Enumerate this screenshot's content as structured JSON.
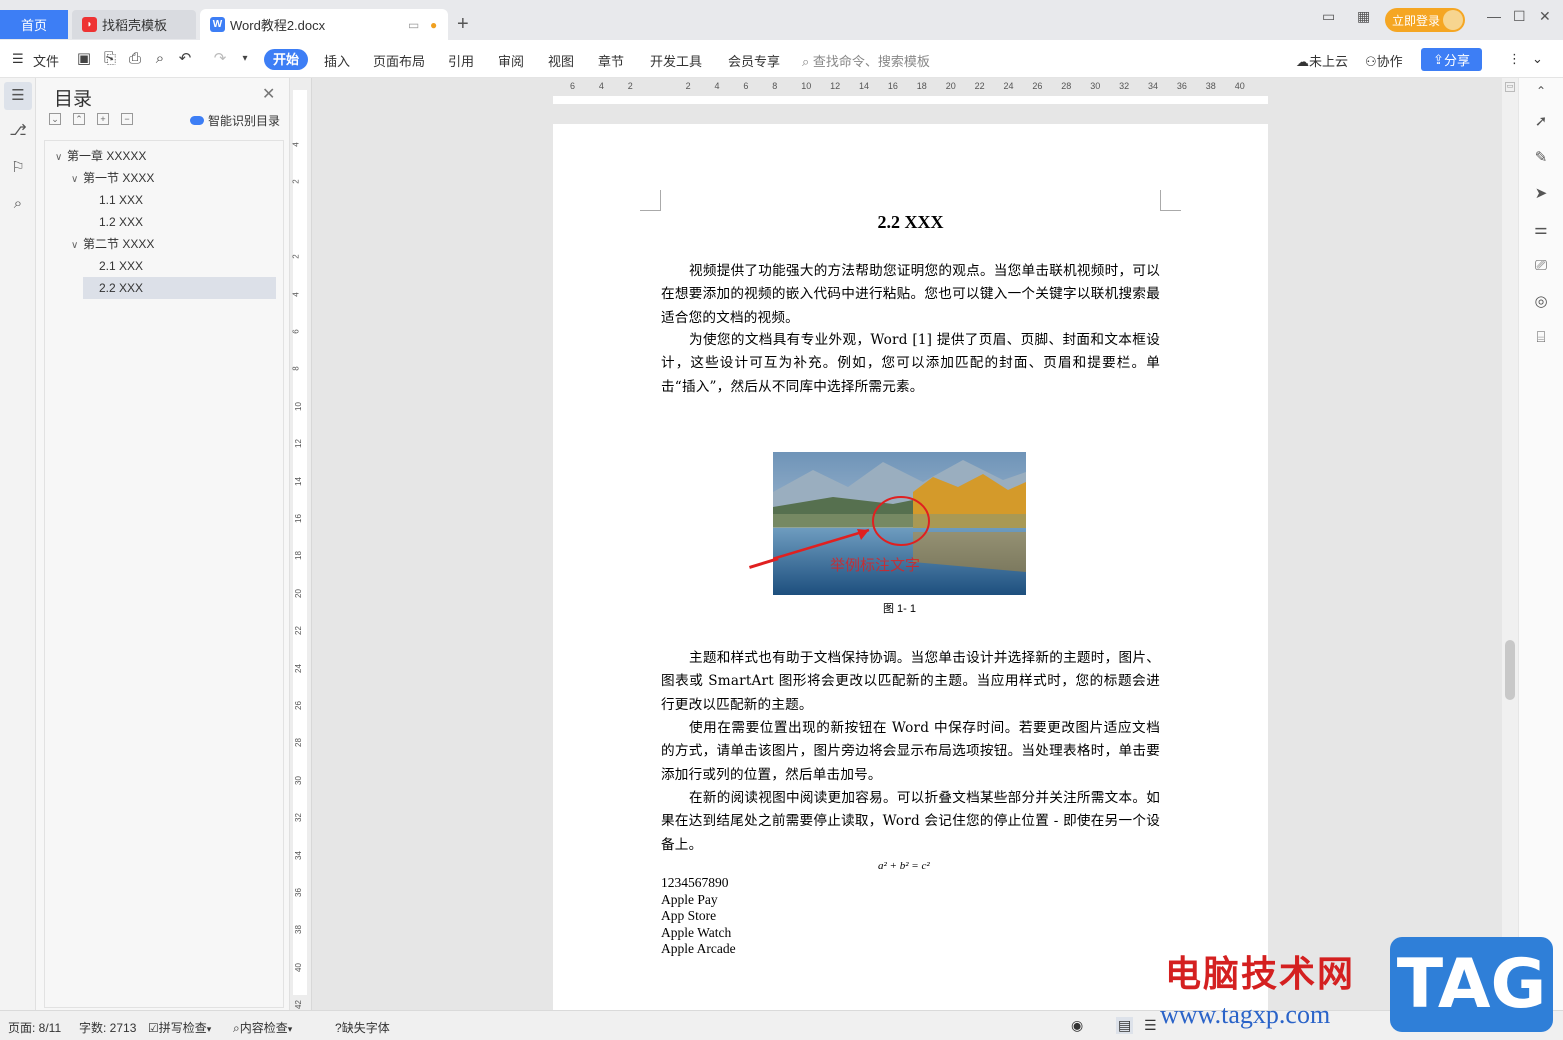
{
  "tabs": {
    "home": "首页",
    "template": "找稻壳模板",
    "doc": "Word教程2.docx",
    "add": "+"
  },
  "titlebar": {
    "login": "立即登录"
  },
  "toolbar": {
    "file": "文件",
    "menus": [
      "开始",
      "插入",
      "页面布局",
      "引用",
      "审阅",
      "视图",
      "章节",
      "开发工具",
      "会员专享"
    ],
    "search_placeholder": "查找命令、搜索模板",
    "cloud": "未上云",
    "collab": "协作",
    "share": "分享"
  },
  "toc": {
    "title": "目录",
    "smart": "智能识别目录",
    "items": [
      {
        "label": "第一章 XXXXX",
        "level": 1,
        "expanded": true
      },
      {
        "label": "第一节 XXXX",
        "level": 2,
        "expanded": true
      },
      {
        "label": "1.1 XXX",
        "level": 3
      },
      {
        "label": "1.2 XXX",
        "level": 3
      },
      {
        "label": "第二节 XXXX",
        "level": 2,
        "expanded": true
      },
      {
        "label": "2.1 XXX",
        "level": 3
      },
      {
        "label": "2.2 XXX",
        "level": 3,
        "selected": true
      }
    ]
  },
  "ruler": {
    "h": [
      "6",
      "4",
      "2",
      "",
      "2",
      "4",
      "6",
      "8",
      "10",
      "12",
      "14",
      "16",
      "18",
      "20",
      "22",
      "24",
      "26",
      "28",
      "30",
      "32",
      "34",
      "36",
      "38",
      "40"
    ],
    "v": [
      "4",
      "2",
      "",
      "2",
      "4",
      "6",
      "8",
      "10",
      "12",
      "14",
      "16",
      "18",
      "20",
      "22",
      "24",
      "26",
      "28",
      "30",
      "32",
      "34",
      "36",
      "38",
      "40",
      "42"
    ]
  },
  "document": {
    "heading": "2.2 XXX",
    "p1": "视频提供了功能强大的方法帮助您证明您的观点。当您单击联机视频时，可以在想要添加的视频的嵌入代码中进行粘贴。您也可以键入一个关键字以联机搜索最适合您的文档的视频。",
    "p2": "为使您的文档具有专业外观，Word [1] 提供了页眉、页脚、封面和文本框设计，这些设计可互为补充。例如，您可以添加匹配的封面、页眉和提要栏。单击“插入”，然后从不同库中选择所需元素。",
    "figure_annotation": "举例标注文字",
    "figure_caption": "图 1- 1",
    "p3": "主题和样式也有助于文档保持协调。当您单击设计并选择新的主题时，图片、图表或 SmartArt 图形将会更改以匹配新的主题。当应用样式时，您的标题会进行更改以匹配新的主题。",
    "p4": "使用在需要位置出现的新按钮在 Word 中保存时间。若要更改图片适应文档的方式，请单击该图片，图片旁边将会显示布局选项按钮。当处理表格时，单击要添加行或列的位置，然后单击加号。",
    "p5": "在新的阅读视图中阅读更加容易。可以折叠文档某些部分并关注所需文本。如果在达到结尾处之前需要停止读取，Word 会记住您的停止位置 - 即使在另一个设备上。",
    "formula": "a² + b² = c²",
    "list": [
      "1234567890",
      "Apple Pay",
      "App Store",
      "Apple Watch",
      "Apple Arcade"
    ]
  },
  "status": {
    "page": "页面: 8/11",
    "words": "字数: 2713",
    "spell": "拼写检查",
    "content": "内容检查",
    "font": "缺失字体"
  },
  "watermark": {
    "text": "电脑技术网",
    "url": "www.tagxp.com",
    "tag": "TAG"
  },
  "colors": {
    "accent": "#3d7ef5",
    "login": "#f5a623",
    "annotation": "#e02020"
  }
}
